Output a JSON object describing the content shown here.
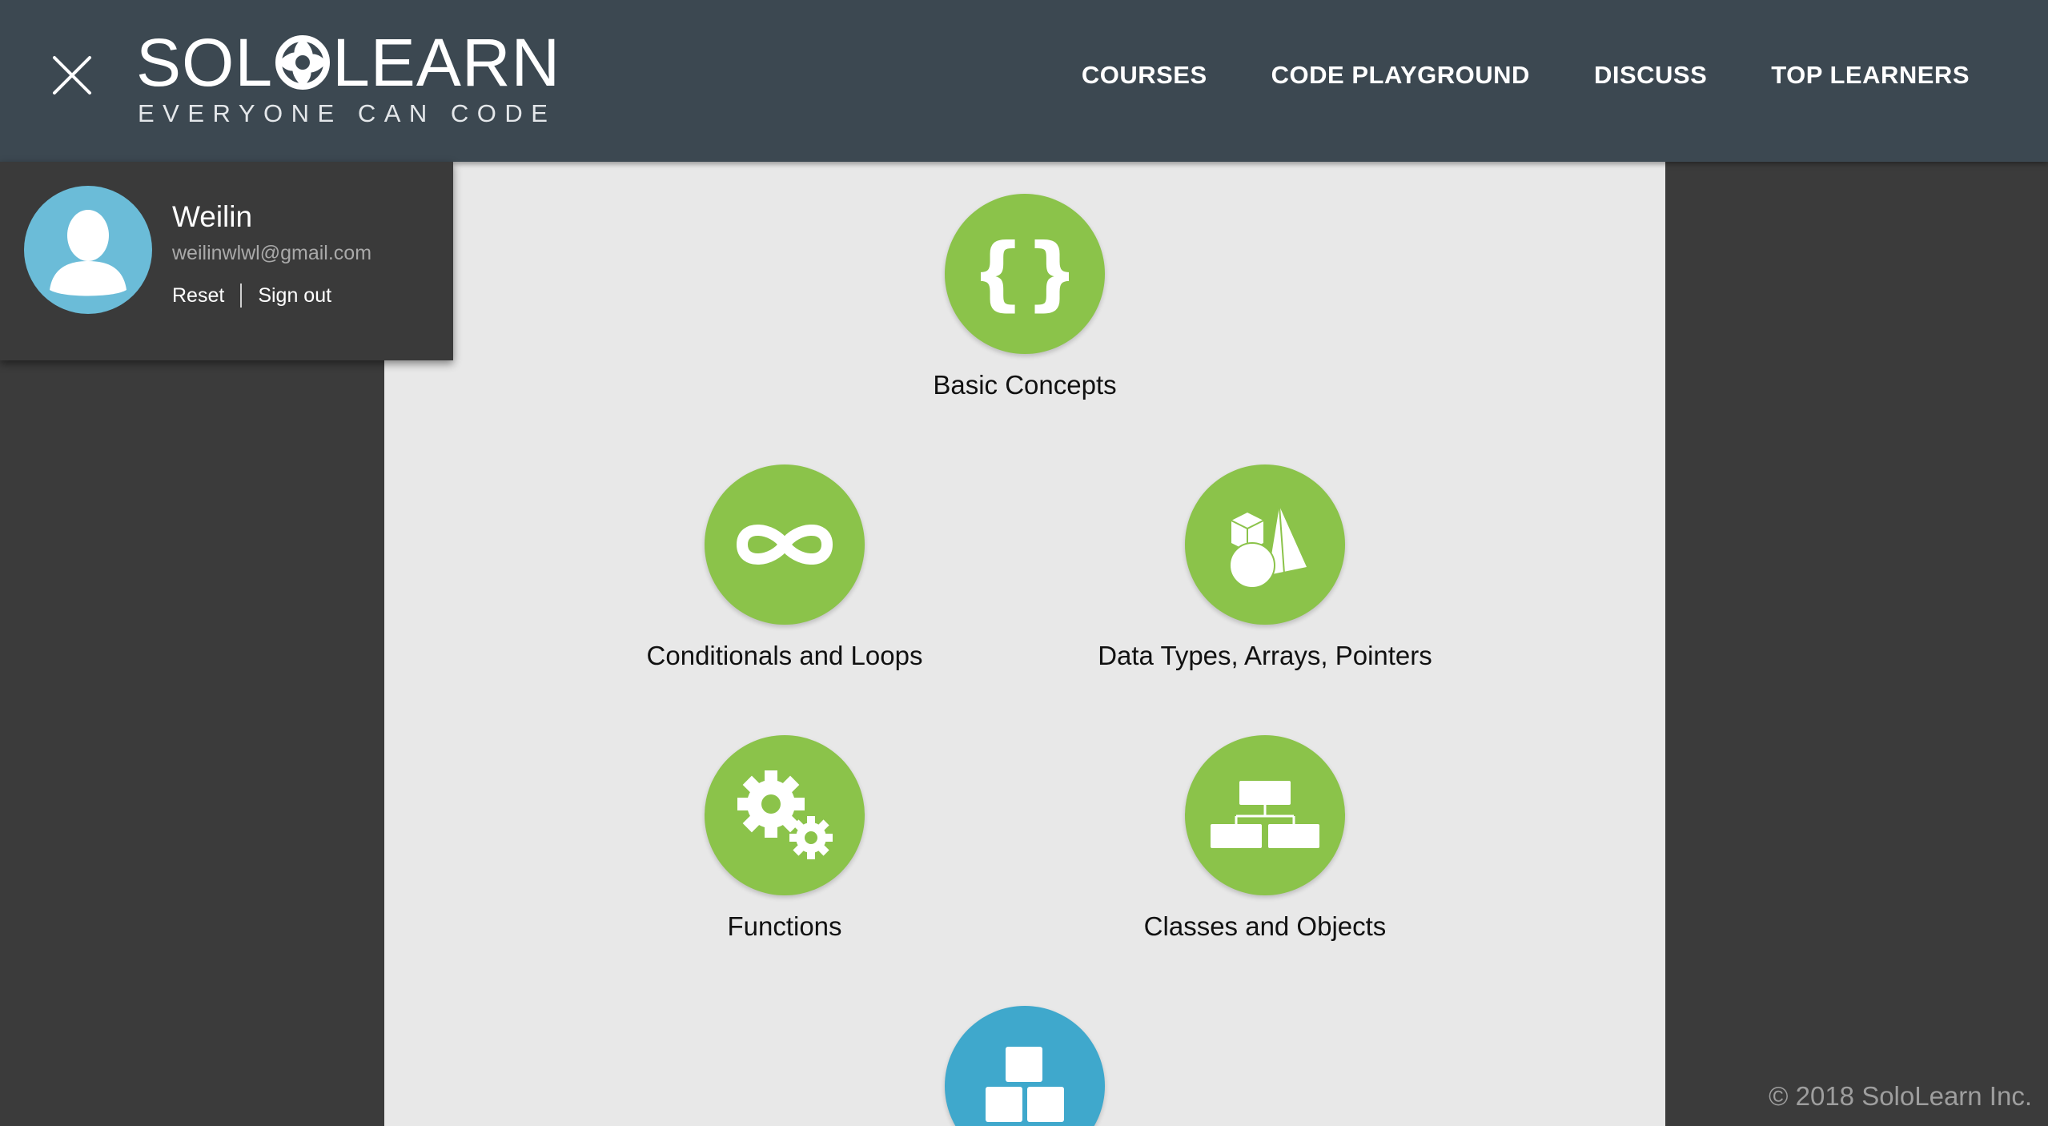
{
  "header": {
    "logo": {
      "word_left": "SOL",
      "word_right": "LEARN",
      "tagline": "EVERYONE CAN CODE"
    },
    "nav": [
      {
        "label": "COURSES"
      },
      {
        "label": "CODE PLAYGROUND"
      },
      {
        "label": "DISCUSS"
      },
      {
        "label": "TOP LEARNERS"
      }
    ]
  },
  "profile": {
    "name": "Weilin",
    "email": "weilinwlwl@gmail.com",
    "reset_label": "Reset",
    "signout_label": "Sign out"
  },
  "modules": [
    {
      "label": "Basic Concepts",
      "icon": "braces-icon",
      "color": "#8bc34a"
    },
    {
      "label": "Conditionals and Loops",
      "icon": "infinity-icon",
      "color": "#8bc34a"
    },
    {
      "label": "Data Types, Arrays, Pointers",
      "icon": "shapes-icon",
      "color": "#8bc34a"
    },
    {
      "label": "Functions",
      "icon": "gears-icon",
      "color": "#8bc34a"
    },
    {
      "label": "Classes and Objects",
      "icon": "hierarchy-icon",
      "color": "#8bc34a"
    },
    {
      "label": "",
      "icon": "blocks-icon",
      "color": "#3fa8cc"
    }
  ],
  "footer": {
    "copyright": "© 2018 SoloLearn Inc."
  },
  "colors": {
    "header_bg": "#3c4851",
    "page_bg": "#3b3b3b",
    "panel_bg": "#e8e8e8",
    "module_green": "#8bc34a",
    "module_blue": "#3fa8cc",
    "avatar_bg": "#6bbcd8"
  }
}
